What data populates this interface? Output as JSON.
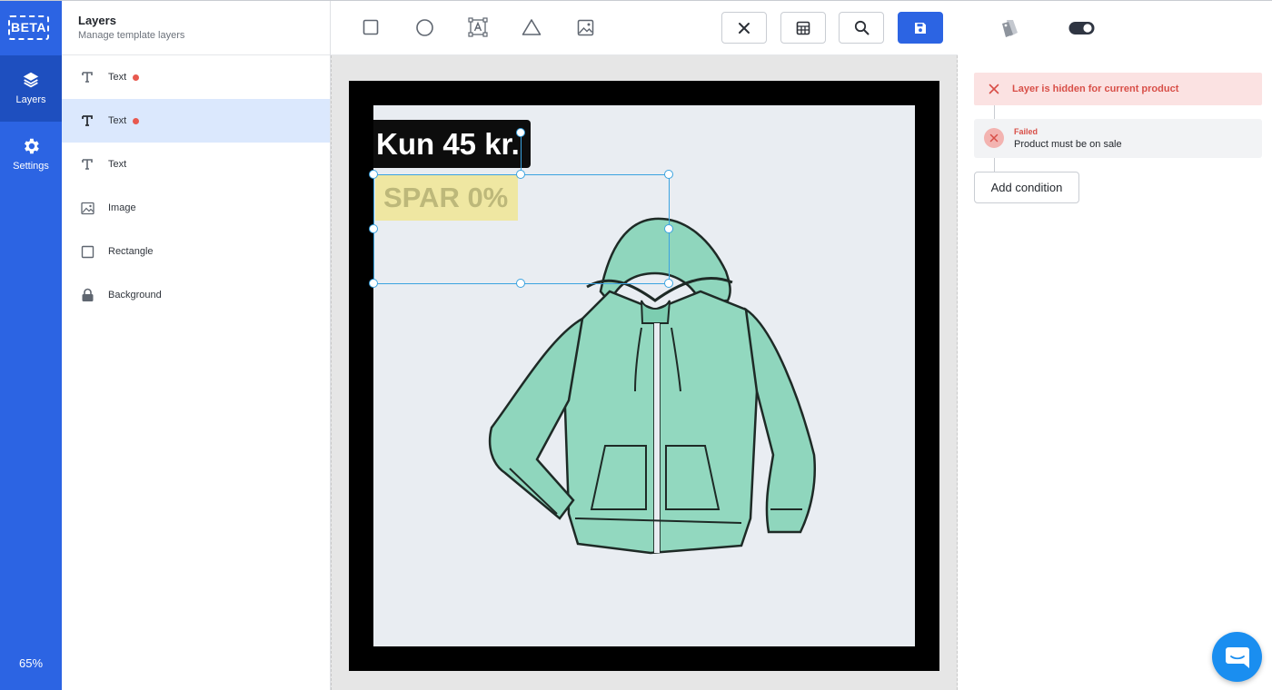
{
  "rail": {
    "badge": "BETA",
    "items": [
      {
        "label": "Layers",
        "icon": "layers-icon"
      },
      {
        "label": "Settings",
        "icon": "gear-icon"
      }
    ],
    "zoom": "65%"
  },
  "layers": {
    "title": "Layers",
    "subtitle": "Manage template layers",
    "items": [
      {
        "label": "Text",
        "icon": "text-icon",
        "warning": true
      },
      {
        "label": "Text",
        "icon": "text-icon",
        "warning": true,
        "selected": true
      },
      {
        "label": "Text",
        "icon": "text-icon",
        "warning": false
      },
      {
        "label": "Image",
        "icon": "image-icon",
        "warning": false
      },
      {
        "label": "Rectangle",
        "icon": "square-icon",
        "warning": false
      },
      {
        "label": "Background",
        "icon": "lock-icon",
        "warning": false
      }
    ]
  },
  "toolbar": {
    "tools": [
      "square-icon",
      "circle-icon",
      "text-box-icon",
      "triangle-icon",
      "image-icon"
    ],
    "buttons": [
      "close-icon",
      "grid-icon",
      "search-icon",
      "save-icon"
    ]
  },
  "canvas": {
    "price_text": "Kun 45 kr.",
    "save_text": "SPAR 0%"
  },
  "right": {
    "warning": "Layer is hidden for current product",
    "condition": {
      "status": "Failed",
      "text": "Product must be on sale"
    },
    "add_condition": "Add condition"
  },
  "colors": {
    "primary": "#2c64e3",
    "danger": "#d84f48",
    "selection": "#3ba3e0",
    "hoodie": "#8fd6bd"
  }
}
